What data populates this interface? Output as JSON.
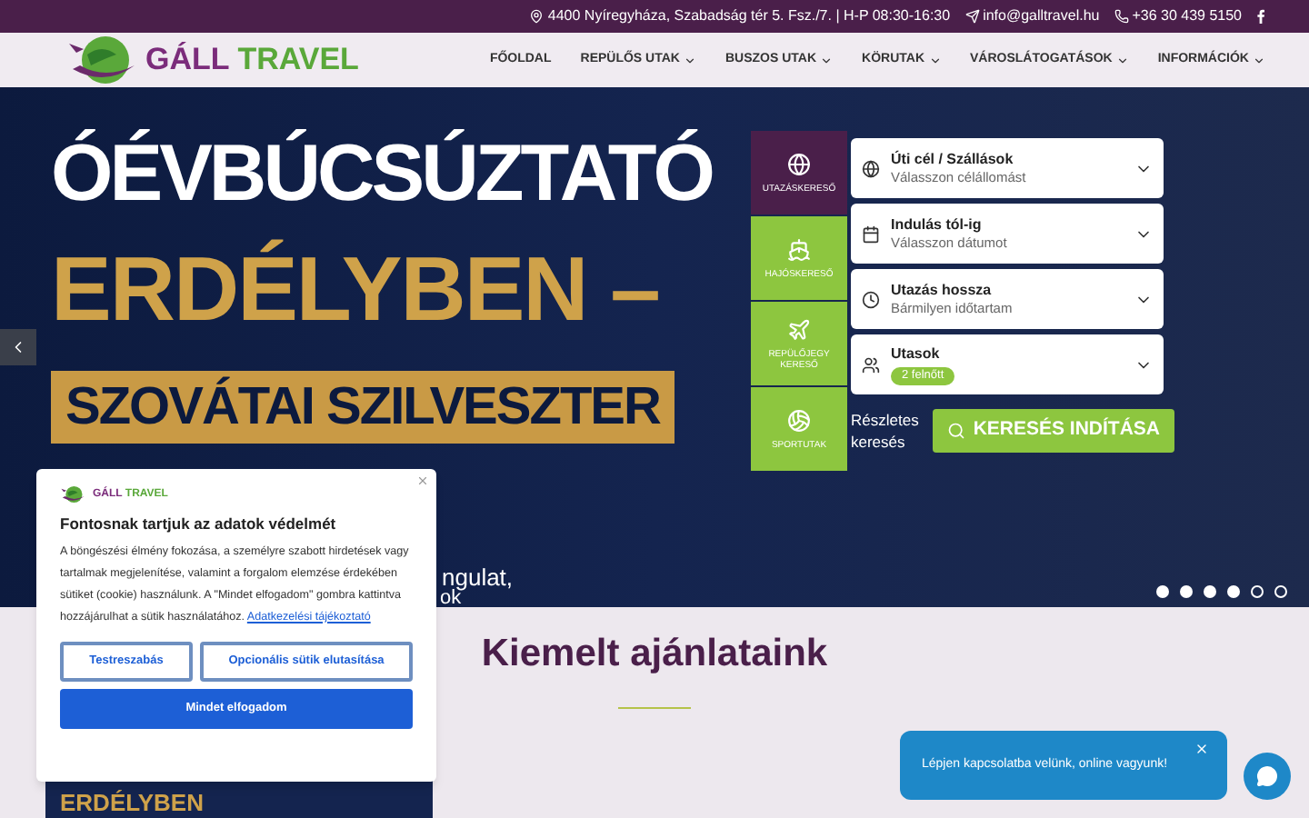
{
  "topbar": {
    "address": "4400 Nyíregyháza, Szabadság tér 5. Fsz./7. | H-P 08:30-16:30",
    "email": "info@galltravel.hu",
    "phone": "+36 30 439 5150"
  },
  "logo": {
    "text_1": "GÁLL",
    "text_2": "TRAVEL"
  },
  "nav": [
    {
      "label": "FŐOLDAL",
      "dropdown": false
    },
    {
      "label": "REPÜLŐS UTAK",
      "dropdown": true
    },
    {
      "label": "BUSZOS UTAK",
      "dropdown": true
    },
    {
      "label": "KÖRUTAK",
      "dropdown": true
    },
    {
      "label": "VÁROSLÁTOGATÁSOK",
      "dropdown": true
    },
    {
      "label": "INFORMÁCIÓK",
      "dropdown": true
    }
  ],
  "hero": {
    "line_1": "ÓÉVBÚCSÚZTATÓ",
    "line_2": "ERDÉLYBEN –",
    "line_3": "SZOVÁTAI SZILVESZTER",
    "caption_1": "ngulat,",
    "caption_2": "ok",
    "dots": [
      {
        "selected": false
      },
      {
        "selected": false
      },
      {
        "selected": false
      },
      {
        "selected": false
      },
      {
        "selected": true
      },
      {
        "selected": true
      }
    ]
  },
  "search": {
    "tabs": [
      {
        "label": "UTAZÁSKERESŐ",
        "selected": true
      },
      {
        "label": "HAJÓSKERESŐ",
        "selected": false
      },
      {
        "label": "REPÜLŐJEGY KERESŐ",
        "selected": false
      },
      {
        "label": "SPORTUTAK",
        "selected": false
      }
    ],
    "fields": [
      {
        "label": "Úti cél / Szállások",
        "value": "Válasszon célállomást",
        "kind": "text"
      },
      {
        "label": "Indulás tól-ig",
        "value": "Válasszon dátumot",
        "kind": "text"
      },
      {
        "label": "Utazás hossza",
        "value": "Bármilyen időtartam",
        "kind": "text"
      },
      {
        "label": "Utasok",
        "value": "2 felnőtt",
        "kind": "badge"
      }
    ],
    "details_link": "Részletes keresés",
    "submit": "KERESÉS INDÍTÁSA"
  },
  "section_title": "Kiemelt ajánlataink",
  "card": {
    "title": "ERDÉLYBEN"
  },
  "cookie": {
    "logo_1": "GÁLL",
    "logo_2": "TRAVEL",
    "title": "Fontosnak tartjuk az adatok védelmét",
    "text": "A böngészési élmény fokozása, a személyre szabott hirdetések vagy tartalmak megjelenítése, valamint a forgalom elemzése érdekében sütiket (cookie) használunk. A \"Mindet elfogadom\" gombra kattintva hozzájárulhat a sütik használatához.",
    "link": "Adatkezelési tájékoztató",
    "buttons": [
      "Testreszabás",
      "Opcionális sütik elutasítása"
    ],
    "accept": "Mindet elfogadom"
  },
  "chat": {
    "message": "Lépjen kapcsolatba velünk, online vagyunk!"
  }
}
